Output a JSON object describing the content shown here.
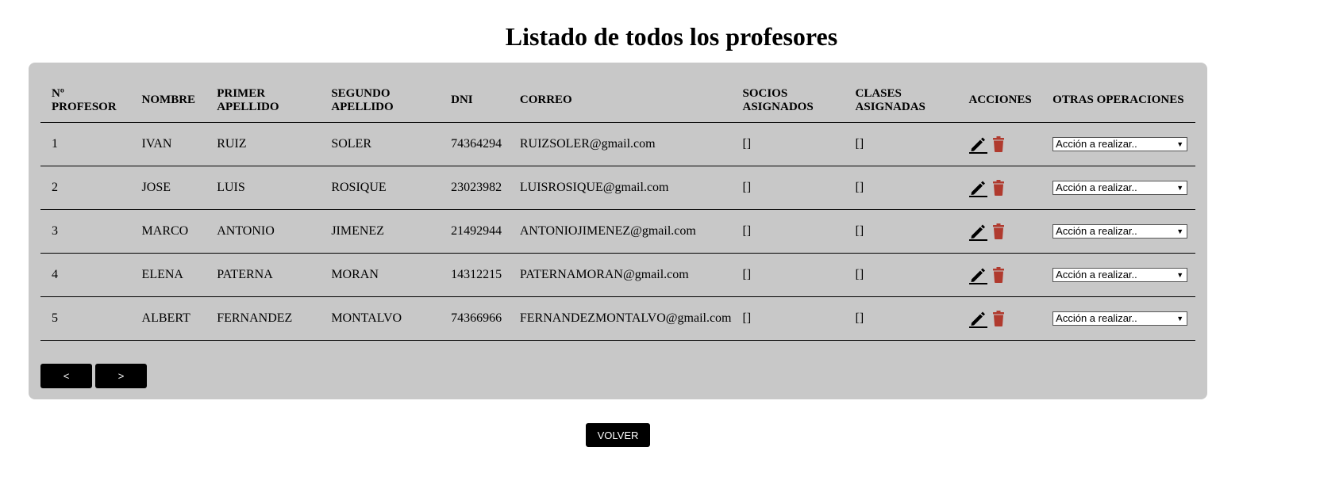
{
  "page": {
    "title": "Listado de todos los profesores"
  },
  "table": {
    "headers": [
      {
        "line1": "Nº",
        "line2": "PROFESOR"
      },
      {
        "line1": "NOMBRE",
        "line2": ""
      },
      {
        "line1": "PRIMER",
        "line2": "APELLIDO"
      },
      {
        "line1": "SEGUNDO",
        "line2": "APELLIDO"
      },
      {
        "line1": "DNI",
        "line2": ""
      },
      {
        "line1": "CORREO",
        "line2": ""
      },
      {
        "line1": "SOCIOS",
        "line2": "ASIGNADOS"
      },
      {
        "line1": "CLASES",
        "line2": "ASIGNADAS"
      },
      {
        "line1": "ACCIONES",
        "line2": ""
      },
      {
        "line1": "OTRAS OPERACIONES",
        "line2": ""
      }
    ],
    "rows": [
      {
        "num": "1",
        "nombre": "IVAN",
        "primer": "RUIZ",
        "segundo": "SOLER",
        "dni": "74364294",
        "correo": "RUIZSOLER@gmail.com",
        "socios": "[]",
        "clases": "[]",
        "select": "Acción a realizar.."
      },
      {
        "num": "2",
        "nombre": "JOSE",
        "primer": "LUIS",
        "segundo": "ROSIQUE",
        "dni": "23023982",
        "correo": "LUISROSIQUE@gmail.com",
        "socios": "[]",
        "clases": "[]",
        "select": "Acción a realizar.."
      },
      {
        "num": "3",
        "nombre": "MARCO",
        "primer": "ANTONIO",
        "segundo": "JIMENEZ",
        "dni": "21492944",
        "correo": "ANTONIOJIMENEZ@gmail.com",
        "socios": "[]",
        "clases": "[]",
        "select": "Acción a realizar.."
      },
      {
        "num": "4",
        "nombre": "ELENA",
        "primer": "PATERNA",
        "segundo": "MORAN",
        "dni": "14312215",
        "correo": "PATERNAMORAN@gmail.com",
        "socios": "[]",
        "clases": "[]",
        "select": "Acción a realizar.."
      },
      {
        "num": "5",
        "nombre": "ALBERT",
        "primer": "FERNANDEZ",
        "segundo": "MONTALVO",
        "dni": "74366966",
        "correo": "FERNANDEZMONTALVO@gmail.com",
        "socios": "[]",
        "clases": "[]",
        "select": "Acción a realizar.."
      }
    ]
  },
  "icons": {
    "edit": "pencil-icon",
    "delete": "trash-icon",
    "delete_color": "#b03a2e"
  },
  "pager": {
    "prev_label": "<",
    "next_label": ">"
  },
  "footer": {
    "back_label": "VOLVER"
  },
  "colors": {
    "panel_bg": "#c8c8c8",
    "button_bg": "#000000"
  }
}
